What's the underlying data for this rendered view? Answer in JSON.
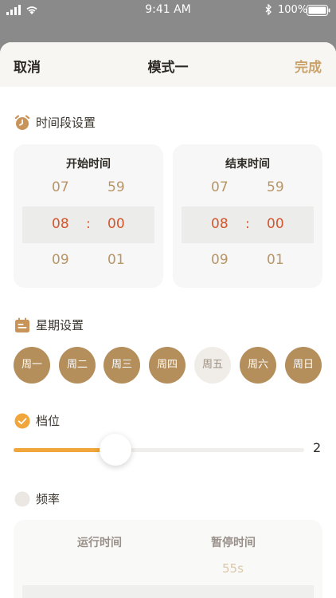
{
  "status_bar": {
    "time": "9:41 AM",
    "battery": "100%"
  },
  "header": {
    "cancel": "取消",
    "title": "模式一",
    "done": "完成"
  },
  "time_section": {
    "title": "时间段设置",
    "start": {
      "label": "开始时间",
      "above": [
        "07",
        "59"
      ],
      "selected": [
        "08",
        "00"
      ],
      "below": [
        "09",
        "01"
      ],
      "separator": ":"
    },
    "end": {
      "label": "结束时间",
      "above": [
        "07",
        "59"
      ],
      "selected": [
        "08",
        "00"
      ],
      "below": [
        "09",
        "01"
      ],
      "separator": ":"
    }
  },
  "week_section": {
    "title": "星期设置",
    "days": [
      {
        "label": "周一",
        "active": true
      },
      {
        "label": "周二",
        "active": true
      },
      {
        "label": "周三",
        "active": true
      },
      {
        "label": "周四",
        "active": true
      },
      {
        "label": "周五",
        "active": false
      },
      {
        "label": "周六",
        "active": true
      },
      {
        "label": "周日",
        "active": true
      }
    ]
  },
  "gear_section": {
    "title": "档位",
    "checked": true,
    "value": "2",
    "fill_fraction": 0.35
  },
  "frequency_section": {
    "title": "频率",
    "checked": false,
    "run_label": "运行时间",
    "pause_label": "暂停时间",
    "pause_value": "55s"
  },
  "colors": {
    "accent": "#b48e5b",
    "done": "#c9a36b",
    "selected_time": "#d3562f",
    "slider": "#f0a63a"
  }
}
